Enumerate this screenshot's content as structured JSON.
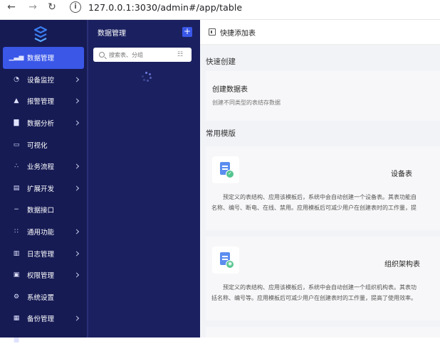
{
  "browser": {
    "url": "127.0.0.1:3030/admin#/app/table"
  },
  "sidebar": {
    "items": [
      {
        "label": "数据管理",
        "icon": "chart-bar-icon",
        "active": true,
        "chevron": false
      },
      {
        "label": "设备监控",
        "icon": "pie-chart-icon",
        "active": false,
        "chevron": true
      },
      {
        "label": "报警管理",
        "icon": "alarm-bell-icon",
        "active": false,
        "chevron": true
      },
      {
        "label": "数据分析",
        "icon": "bar-chart-icon",
        "active": false,
        "chevron": true
      },
      {
        "label": "可视化",
        "icon": "monitor-icon",
        "active": false,
        "chevron": false
      },
      {
        "label": "业务流程",
        "icon": "share-nodes-icon",
        "active": false,
        "chevron": true
      },
      {
        "label": "扩展开发",
        "icon": "layout-icon",
        "active": false,
        "chevron": true
      },
      {
        "label": "数据接口",
        "icon": "api-link-icon",
        "active": false,
        "chevron": false
      },
      {
        "label": "通用功能",
        "icon": "grid-apps-icon",
        "active": false,
        "chevron": true
      },
      {
        "label": "日志管理",
        "icon": "log-file-icon",
        "active": false,
        "chevron": true
      },
      {
        "label": "权限管理",
        "icon": "lock-icon",
        "active": false,
        "chevron": true
      },
      {
        "label": "系统设置",
        "icon": "gear-icon",
        "active": false,
        "chevron": false
      },
      {
        "label": "备份管理",
        "icon": "database-icon",
        "active": false,
        "chevron": true
      },
      {
        "label": "",
        "icon": "folder-icon",
        "active": false,
        "chevron": false
      }
    ]
  },
  "panel": {
    "title": "数据管理",
    "add_label": "+",
    "search_placeholder": "搜索表、分组"
  },
  "main": {
    "header_title": "快捷添加表",
    "quick_create_label": "快速创建",
    "create_card": {
      "title": "创建数据表",
      "desc": "创建不同类型的表结存数据"
    },
    "templates_label": "常用模版",
    "templates": [
      {
        "name": "设备表",
        "desc_line1": "预定义的表结构、应用该模板后，系统中会自动创建一个设备表。其表功能自",
        "desc_line2": "名称、编号、断电、在线、禁用。应用模板后可减少用户在创建表时的工作量，提"
      },
      {
        "name": "组织架构表",
        "desc_line1": "预定义的表结构、应用该模板后，系统中会自动创建一个组织机构表。其表功",
        "desc_line2": "括名称、编号等。应用模板后可减少用户在创建表时的工作量，提高了使用效率。"
      }
    ]
  },
  "colors": {
    "sidebar_bg": "#161b54",
    "panel_bg": "#1b2160",
    "accent": "#3a57e8",
    "badge_green": "#55c58f"
  }
}
